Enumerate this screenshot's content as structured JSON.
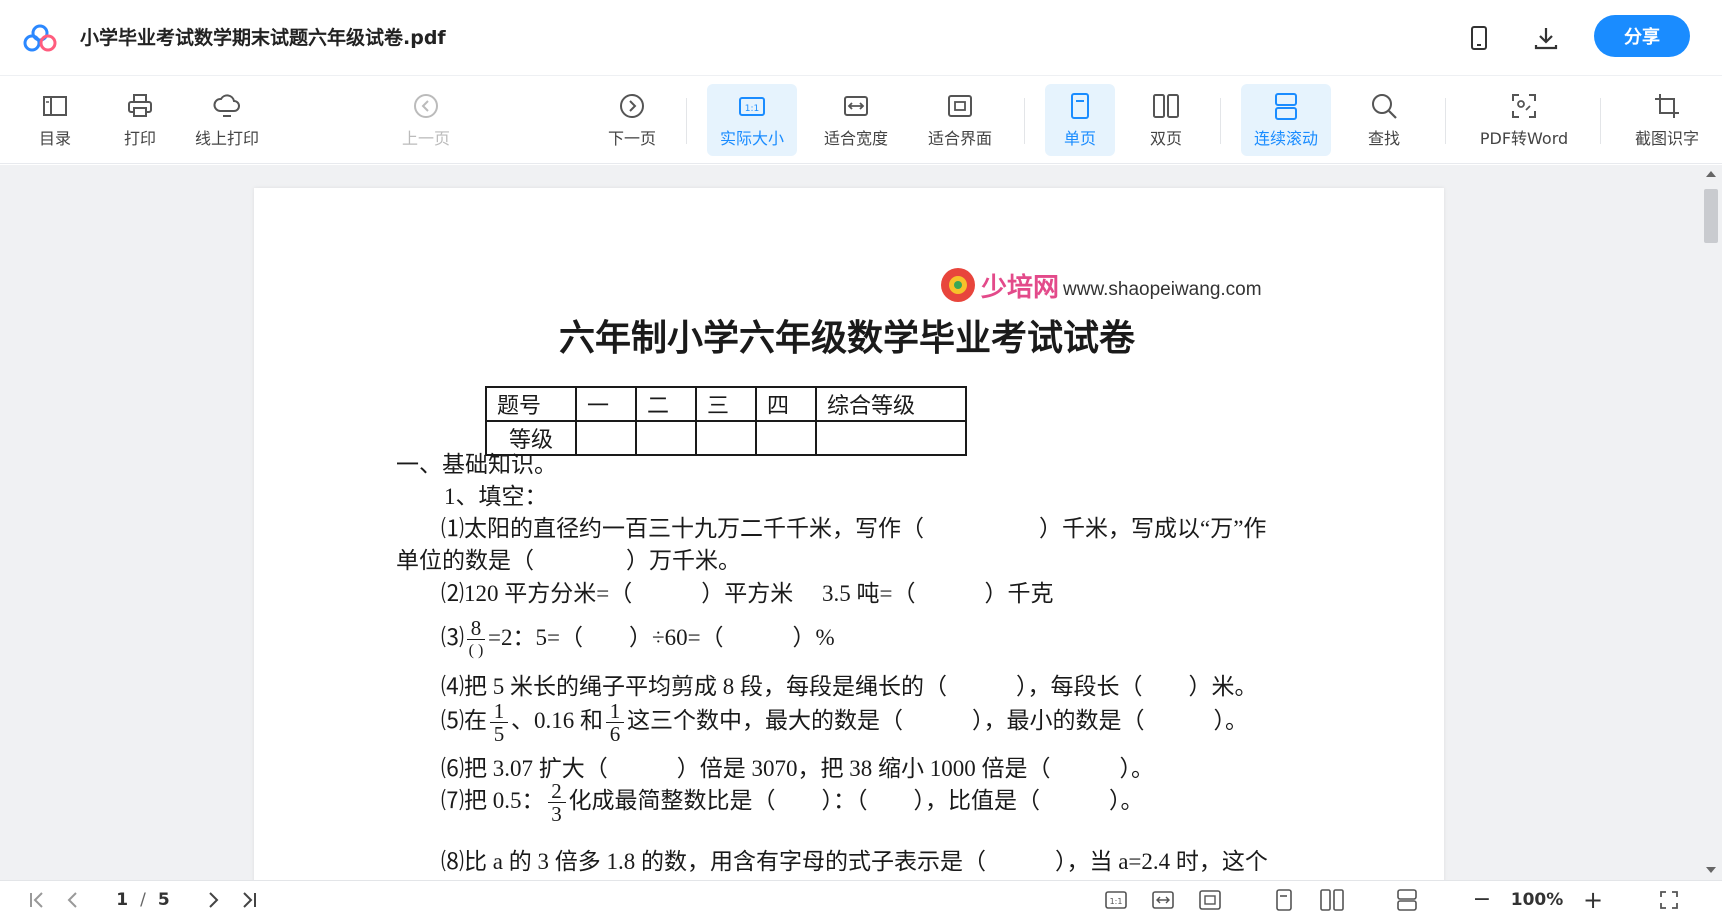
{
  "titlebar": {
    "file_name": "小学毕业考试数学期末试题六年级试卷.pdf",
    "share_label": "分享",
    "icons": [
      "app-logo-icon",
      "mobile-icon",
      "download-icon"
    ]
  },
  "toolbar": {
    "items": [
      {
        "name": "toc",
        "label": "目录",
        "icon": "toc-icon"
      },
      {
        "name": "print",
        "label": "打印",
        "icon": "printer-icon"
      },
      {
        "name": "online-print",
        "label": "线上打印",
        "icon": "cloud-print-icon"
      },
      {
        "name": "prev-page",
        "label": "上一页",
        "icon": "chevron-left-circle-icon"
      },
      {
        "name": "next-page",
        "label": "下一页",
        "icon": "chevron-right-circle-icon"
      },
      {
        "name": "actual-size",
        "label": "实际大小",
        "icon": "one-to-one-icon",
        "active": true
      },
      {
        "name": "fit-width",
        "label": "适合宽度",
        "icon": "fit-width-icon"
      },
      {
        "name": "fit-page",
        "label": "适合界面",
        "icon": "fit-page-icon"
      },
      {
        "name": "single-page",
        "label": "单页",
        "icon": "single-page-icon",
        "active": true
      },
      {
        "name": "double-page",
        "label": "双页",
        "icon": "double-page-icon"
      },
      {
        "name": "continuous",
        "label": "连续滚动",
        "icon": "continuous-scroll-icon",
        "active": true
      },
      {
        "name": "find",
        "label": "查找",
        "icon": "search-icon"
      },
      {
        "name": "pdf-to-word",
        "label": "PDF转Word",
        "icon": "convert-icon"
      },
      {
        "name": "ocr",
        "label": "截图识字",
        "icon": "crop-icon"
      }
    ],
    "page_current": "1",
    "page_sep": "/",
    "page_total": "5"
  },
  "document": {
    "watermark_brand": "少培网",
    "watermark_url": "www.shaopeiwang.com",
    "heading": "六年制小学六年级数学毕业考试试卷",
    "table": {
      "row1": [
        "题号",
        "一",
        "二",
        "三",
        "四",
        "综合等级"
      ],
      "row2": [
        "等级",
        "",
        "",
        "",
        "",
        ""
      ]
    },
    "section1": "一、基础知识。",
    "sub1": "1、填空：",
    "q1a": "⑴太阳的直径约一百三十九万二千千米，写作（　　　　　）千米，写成以“万”作",
    "q1b": "单位的数是（　　　　）万千米。",
    "q2": "⑵120 平方分米=（　　　）平方米　 3.5 吨=（　　　）千克",
    "q3_prefix": "⑶",
    "q3_num": "8",
    "q3_den": "( )",
    "q3_rest": "=2：5=（　　）÷60=（　　　）%",
    "q4": "⑷把 5 米长的绳子平均剪成 8 段，每段是绳长的（　　　），每段长（　　）米。",
    "q5_prefix": "⑸在",
    "q5_num1": "1",
    "q5_den1": "5",
    "q5_mid": "、0.16 和",
    "q5_num2": "1",
    "q5_den2": "6",
    "q5_rest": "这三个数中，最大的数是（　　　），最小的数是（　　　）。",
    "q6": "⑹把 3.07 扩大（　　　）倍是 3070，把 38 缩小 1000 倍是（　　　）。",
    "q7_prefix": "⑺把 0.5：",
    "q7_num": "2",
    "q7_den": "3",
    "q7_rest": "化成最简整数比是（　　）：（　　），比值是（　　　）。",
    "q8": "⑻比 a 的 3 倍多 1.8 的数，用含有字母的式子表示是（　　　），当 a=2.4 时，这个"
  },
  "statusbar": {
    "page_current": "1",
    "page_sep": "/",
    "page_total": "5",
    "zoom": "100%",
    "minus": "−",
    "plus": "+"
  },
  "colors": {
    "accent": "#1a8cff",
    "active_bg": "#e6f3fd",
    "viewer_bg": "#f0f1f3"
  }
}
